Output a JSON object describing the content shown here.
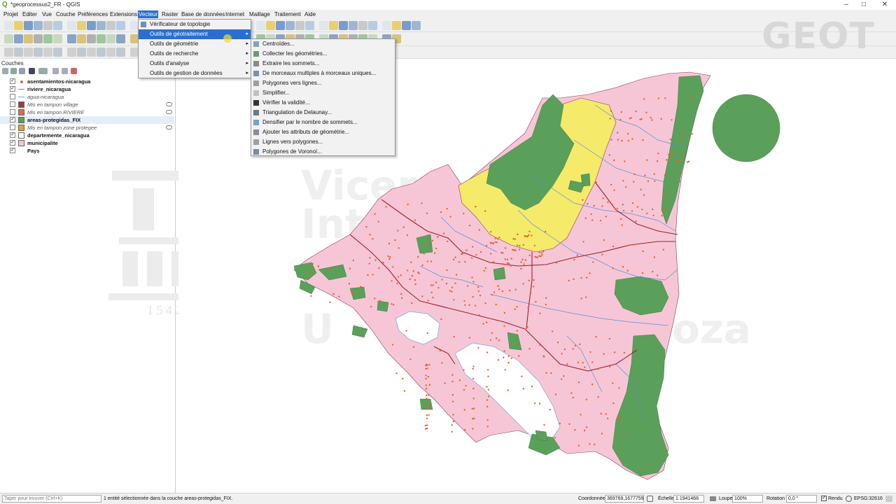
{
  "window": {
    "title": "*geoprocessus2_FR - QGIS",
    "app_icon": "qgis-logo-icon"
  },
  "menubar": [
    "Projet",
    "Editer",
    "Vue",
    "Couche",
    "Préférences",
    "Extensions",
    "Vecteur",
    "Raster",
    "Base de données",
    "Internet",
    "Maillage",
    "Traitement",
    "Aide"
  ],
  "vector_menu": {
    "items": [
      {
        "label": "Vérificateur de topologie",
        "submenu": false
      },
      {
        "label": "Outils de géotraitement",
        "submenu": true
      },
      {
        "label": "Outils de géométrie",
        "submenu": true
      },
      {
        "label": "Outils de recherche",
        "submenu": true
      },
      {
        "label": "Outils d'analyse",
        "submenu": true
      },
      {
        "label": "Outils de gestion de données",
        "submenu": true
      }
    ],
    "active_index": 1
  },
  "geometry_submenu": {
    "items": [
      "Centroïdes...",
      "Collecter les géométries...",
      "Extraire les sommets...",
      "De morceaux multiples à morceaux uniques...",
      "Polygones vers lignes...",
      "Simplifier...",
      "Vérifier la validité...",
      "Triangulation de Delaunay...",
      "Densifier par le nombre de sommets...",
      "Ajouter les attributs de géométrie...",
      "Lignes vers polygones...",
      "Polygones de Voronoï..."
    ]
  },
  "layers": {
    "panel_title": "Couches",
    "items": [
      {
        "name": "asentamientos-nicaragua",
        "checked": true,
        "style": "bold",
        "symbol": "point",
        "color": "#e8602c"
      },
      {
        "name": "riviere_nicaragua",
        "checked": true,
        "style": "bold",
        "symbol": "line",
        "color": "#5a8fd6"
      },
      {
        "name": "agua-nicaragua",
        "checked": false,
        "style": "italic",
        "symbol": "line",
        "color": "#7fa6d8"
      },
      {
        "name": "Mis en tampon village",
        "checked": false,
        "style": "italic",
        "symbol": "fill",
        "color": "#a33a3a"
      },
      {
        "name": "Mis en tampon RIVIERE",
        "checked": false,
        "style": "italic",
        "symbol": "fill",
        "color": "#e06a50"
      },
      {
        "name": "areas-protegidas_FIX",
        "checked": true,
        "style": "bold",
        "symbol": "fill",
        "color": "#5aa05a"
      },
      {
        "name": "Mis en tampon zone protegee",
        "checked": false,
        "style": "italic",
        "symbol": "fill",
        "color": "#f0a020"
      },
      {
        "name": "departemente_nicaragua",
        "checked": true,
        "style": "bold",
        "symbol": "fill",
        "color": "#ffffff"
      },
      {
        "name": "municipalite",
        "checked": true,
        "style": "bold",
        "symbol": "fill",
        "color": "#f7c6d6"
      },
      {
        "name": "Pays",
        "checked": true,
        "style": "bold",
        "symbol": "none",
        "color": "#ffffff"
      }
    ]
  },
  "watermark": {
    "logo_text": "GEOT",
    "bg_text_lines": [
      "Vicerr",
      "Inte",
      "U",
      "oza"
    ],
    "year": "1 5 4 2"
  },
  "status": {
    "search_placeholder": "Taper pour trouver (Ctrl+K)",
    "message": "1 entité sélectionnée dans la couche areas-protegidas_FIX.",
    "coord_label": "Coordonnée",
    "coord_value": "369769,1677759",
    "scale_label": "Échelle",
    "scale_value": "1:1941466",
    "zoom_label": "Loupe",
    "zoom_value": "100%",
    "rotation_label": "Rotation",
    "rotation_value": "0,0 °",
    "render_label": "Rendu",
    "crs": "EPSG:32616"
  },
  "colors": {
    "municipality_fill": "#f7c6d6",
    "protected_fill": "#5aa05a",
    "yellow_fill": "#f5ea6a",
    "river": "#5a8fd6",
    "department_border": "#a0202a",
    "settlement": "#e8602c",
    "menu_highlight": "#2a6fd0"
  }
}
